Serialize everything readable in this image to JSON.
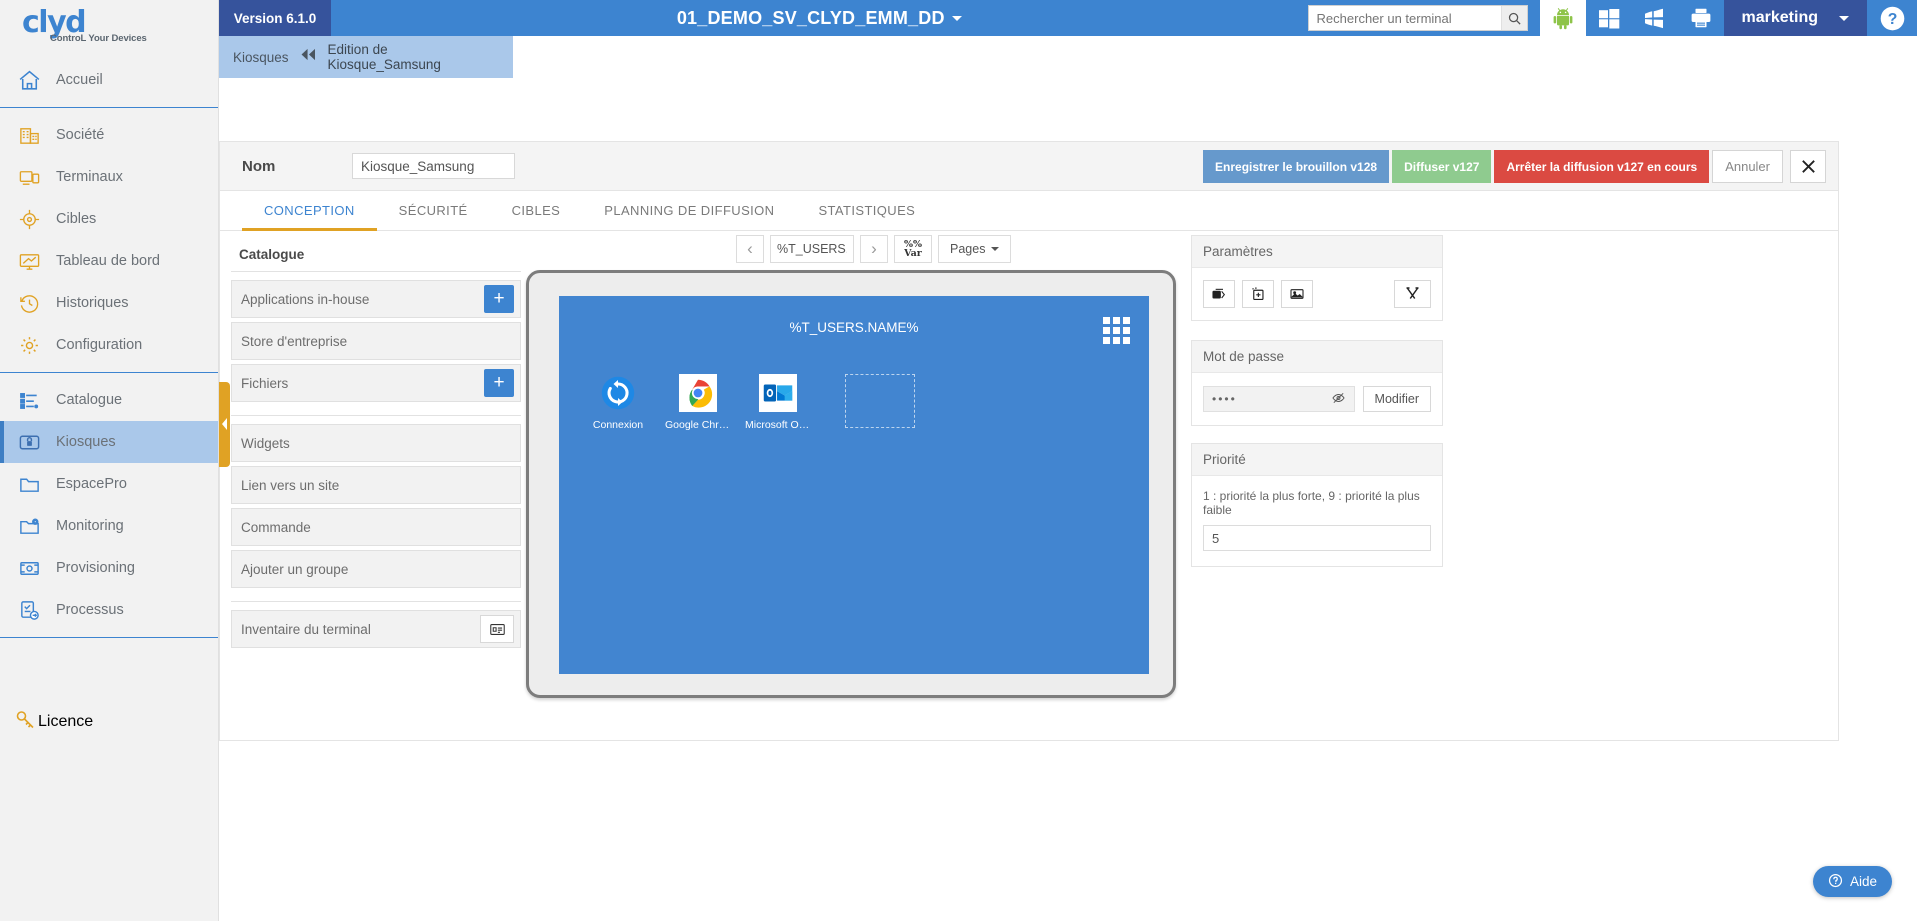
{
  "brand": {
    "name": "clyd",
    "tagline": "ControL Your Devices"
  },
  "topbar": {
    "version": "Version 6.1.0",
    "title": "01_DEMO_SV_CLYD_EMM_DD",
    "search_placeholder": "Rechercher un terminal",
    "search_value": "",
    "user": "marketing",
    "icons": [
      "android-icon",
      "windows10-icon",
      "windows-legacy-icon",
      "printer-icon",
      "help-icon"
    ]
  },
  "breadcrumb": {
    "root": "Kiosques",
    "current": "Edition de Kiosque_Samsung"
  },
  "sidebar": {
    "group1": [
      {
        "label": "Accueil",
        "icon": "home-icon"
      }
    ],
    "group2": [
      {
        "label": "Société",
        "icon": "building-icon"
      },
      {
        "label": "Terminaux",
        "icon": "devices-icon"
      },
      {
        "label": "Cibles",
        "icon": "target-icon"
      },
      {
        "label": "Tableau de bord",
        "icon": "dashboard-icon"
      },
      {
        "label": "Historiques",
        "icon": "history-clock-icon"
      },
      {
        "label": "Configuration",
        "icon": "gear-icon"
      }
    ],
    "group3": [
      {
        "label": "Catalogue",
        "icon": "catalog-list-icon"
      },
      {
        "label": "Kiosques",
        "icon": "lock-icon",
        "active": true
      },
      {
        "label": "EspacePro",
        "icon": "folder-icon"
      },
      {
        "label": "Monitoring",
        "icon": "folder-gear-icon"
      },
      {
        "label": "Provisioning",
        "icon": "provision-icon"
      },
      {
        "label": "Processus",
        "icon": "process-icon"
      }
    ],
    "licence": {
      "label": "Licence",
      "icon": "key-icon"
    }
  },
  "form": {
    "name_label": "Nom",
    "name_value": "Kiosque_Samsung",
    "actions": {
      "save_draft": "Enregistrer le brouillon v128",
      "publish": "Diffuser v127",
      "stop_publish": "Arrêter la diffusion v127 en cours",
      "cancel": "Annuler",
      "close": "✕"
    }
  },
  "tabs": [
    {
      "label": "CONCEPTION",
      "active": true
    },
    {
      "label": "SÉCURITÉ",
      "active": false
    },
    {
      "label": "CIBLES",
      "active": false
    },
    {
      "label": "PLANNING DE DIFFUSION",
      "active": false
    },
    {
      "label": "STATISTIQUES",
      "active": false
    }
  ],
  "catalogue": {
    "title": "Catalogue",
    "group_a": [
      {
        "label": "Applications in-house",
        "add": "+"
      },
      {
        "label": "Store d'entreprise",
        "add": null
      },
      {
        "label": "Fichiers",
        "add": "+"
      }
    ],
    "group_b": [
      {
        "label": "Widgets"
      },
      {
        "label": "Lien vers un site"
      },
      {
        "label": "Commande"
      },
      {
        "label": "Ajouter un groupe"
      }
    ],
    "group_c": [
      {
        "label": "Inventaire du terminal",
        "icon": "inventory-icon"
      }
    ]
  },
  "preview": {
    "prev": "‹",
    "next": "›",
    "page_field": "%T_USERS.NAI",
    "var_line1": "%%",
    "var_line2": "Var",
    "pages_label": "Pages",
    "screen_title": "%T_USERS.NAME%",
    "apps": [
      {
        "label": "Connexion",
        "icon": "connexion-sync-icon"
      },
      {
        "label": "Google Chro...",
        "icon": "google-chrome-icon"
      },
      {
        "label": "Microsoft Ou...",
        "icon": "microsoft-outlook-icon"
      }
    ],
    "empty_slot": true
  },
  "params_panel": {
    "title": "Paramètres",
    "buttons": [
      "layers-icon",
      "add-page-icon",
      "image-icon",
      "tools-icon"
    ]
  },
  "password_panel": {
    "title": "Mot de passe",
    "value": "••••",
    "toggle_icon": "eye-off-icon",
    "modify_label": "Modifier"
  },
  "priority_panel": {
    "title": "Priorité",
    "hint": "1 : priorité la plus forte, 9 : priorité la plus faible",
    "value": "5"
  },
  "help_fab": {
    "label": "Aide",
    "icon": "question-circle-icon"
  },
  "colors": {
    "brand_blue": "#3d84d0",
    "dark_blue": "#36539c",
    "accent_orange": "#e0a224",
    "green": "#8fcb8f",
    "red": "#db4a42",
    "screen_blue": "#4285d0"
  }
}
